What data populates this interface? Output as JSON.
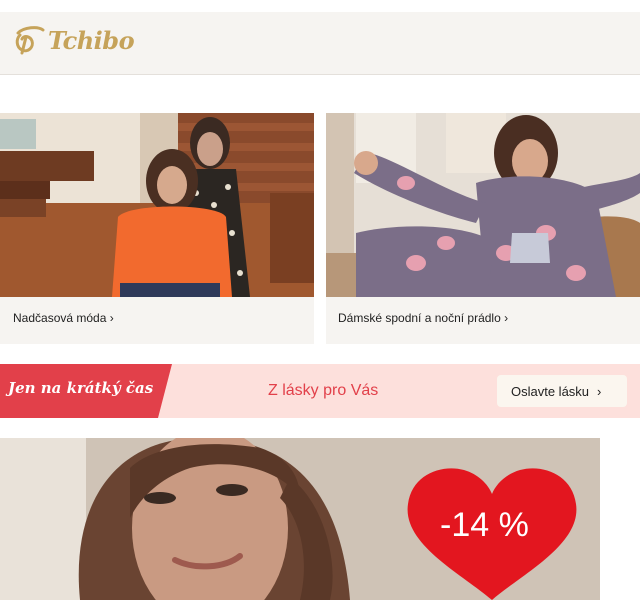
{
  "header": {
    "logo_text": "Tchibo",
    "logo_icon": "tchibo-bean-icon",
    "brand_color": "#c6a35a"
  },
  "cards": [
    {
      "label": "Nadčasová móda ›",
      "image": "two-women-sweater-dress-photo"
    },
    {
      "label": "Dámské spodní a noční prádlo ›",
      "image": "woman-pajamas-sofa-photo"
    }
  ],
  "promo": {
    "tag": "Jen na krátký čas",
    "headline": "Z lásky pro Vás",
    "button_label": "Oslavte lásku",
    "button_icon": "chevron-right-icon",
    "tag_color": "#e2404a",
    "bg_color": "#fde0dc"
  },
  "hero": {
    "image": "woman-portrait-photo",
    "badge_text": "-14 %",
    "badge_shape": "heart-icon",
    "badge_color": "#e3161f"
  }
}
